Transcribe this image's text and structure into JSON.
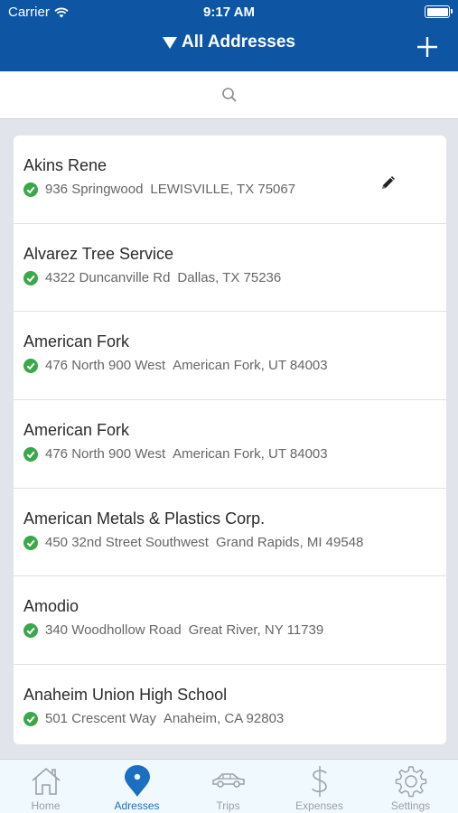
{
  "status_bar": {
    "carrier": "Carrier",
    "time": "9:17 AM"
  },
  "nav": {
    "title": "All Addresses"
  },
  "addresses": [
    {
      "name": "Akins Rene",
      "street": "936 Springwood",
      "city": "LEWISVILLE, TX 75067"
    },
    {
      "name": "Alvarez Tree Service",
      "street": "4322 Duncanville Rd",
      "city": "Dallas, TX 75236"
    },
    {
      "name": "American Fork",
      "street": "476 North 900 West",
      "city": "American Fork, UT 84003"
    },
    {
      "name": "American Fork",
      "street": "476 North 900 West",
      "city": "American Fork, UT 84003"
    },
    {
      "name": "American Metals & Plastics Corp.",
      "street": "450 32nd Street Southwest",
      "city": "Grand Rapids, MI 49548"
    },
    {
      "name": "Amodio",
      "street": "340 Woodhollow Road",
      "city": "Great River, NY 11739"
    },
    {
      "name": "Anaheim Union High School",
      "street": "501 Crescent Way",
      "city": "Anaheim, CA 92803"
    }
  ],
  "tabs": [
    {
      "label": "Home",
      "icon": "home-icon"
    },
    {
      "label": "Adresses",
      "icon": "map-pin-icon"
    },
    {
      "label": "Trips",
      "icon": "car-icon"
    },
    {
      "label": "Expenses",
      "icon": "dollar-icon"
    },
    {
      "label": "Settings",
      "icon": "gear-icon"
    }
  ],
  "colors": {
    "header": "#0e56a4",
    "active_tab": "#1a6fc1",
    "check": "#3aa84a",
    "inactive_tab": "#9aa0a6"
  }
}
